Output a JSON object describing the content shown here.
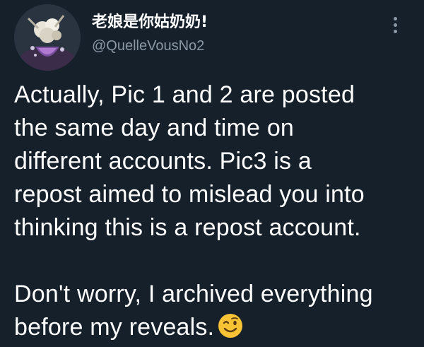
{
  "author": {
    "display_name": "老娘是你姑奶奶!",
    "handle": "@QuelleVousNo2",
    "avatar_icon": "avatar-flower-illustration"
  },
  "menu": {
    "icon": "more-vertical-icon"
  },
  "tweet": {
    "lines": [
      "Actually, Pic 1 and 2 are posted",
      "the same day and time on",
      "different accounts. Pic3 is a",
      "repost aimed to mislead you into",
      "thinking this is a repost account.",
      "",
      "Don't worry, I archived everything",
      "before my reveals."
    ],
    "emoji": "winking-face-emoji"
  },
  "colors": {
    "background": "#15202b",
    "text": "#ffffff",
    "secondary": "#8b98a5",
    "emoji_yellow": "#f7c233"
  }
}
